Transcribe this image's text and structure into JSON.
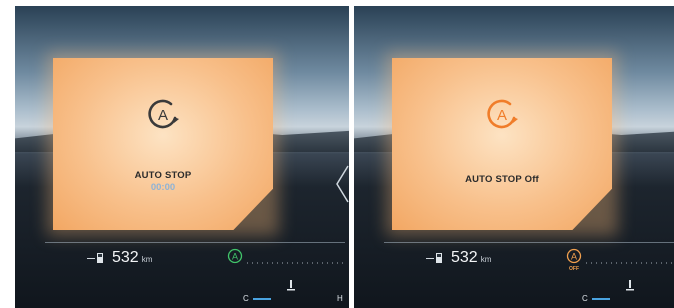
{
  "panels": [
    {
      "popup": {
        "title": "AUTO STOP",
        "timer": "00:00",
        "icon": "auto-stop-icon",
        "icon_color": "#3a3a3a"
      },
      "trip": {
        "range_value": "532",
        "range_unit": "km",
        "status_icon": "auto-stop-active-icon",
        "status_color": "#41c56a",
        "status_sub": ""
      },
      "temperature": {
        "cold_label": "C",
        "hot_label": "H"
      }
    },
    {
      "popup": {
        "title": "AUTO STOP Off",
        "timer": "",
        "icon": "auto-stop-off-icon",
        "icon_color": "#f07d2a"
      },
      "trip": {
        "range_value": "532",
        "range_unit": "km",
        "status_icon": "auto-stop-off-icon",
        "status_color": "#f2a04e",
        "status_sub": "OFF"
      },
      "temperature": {
        "cold_label": "C",
        "hot_label": ""
      }
    }
  ]
}
